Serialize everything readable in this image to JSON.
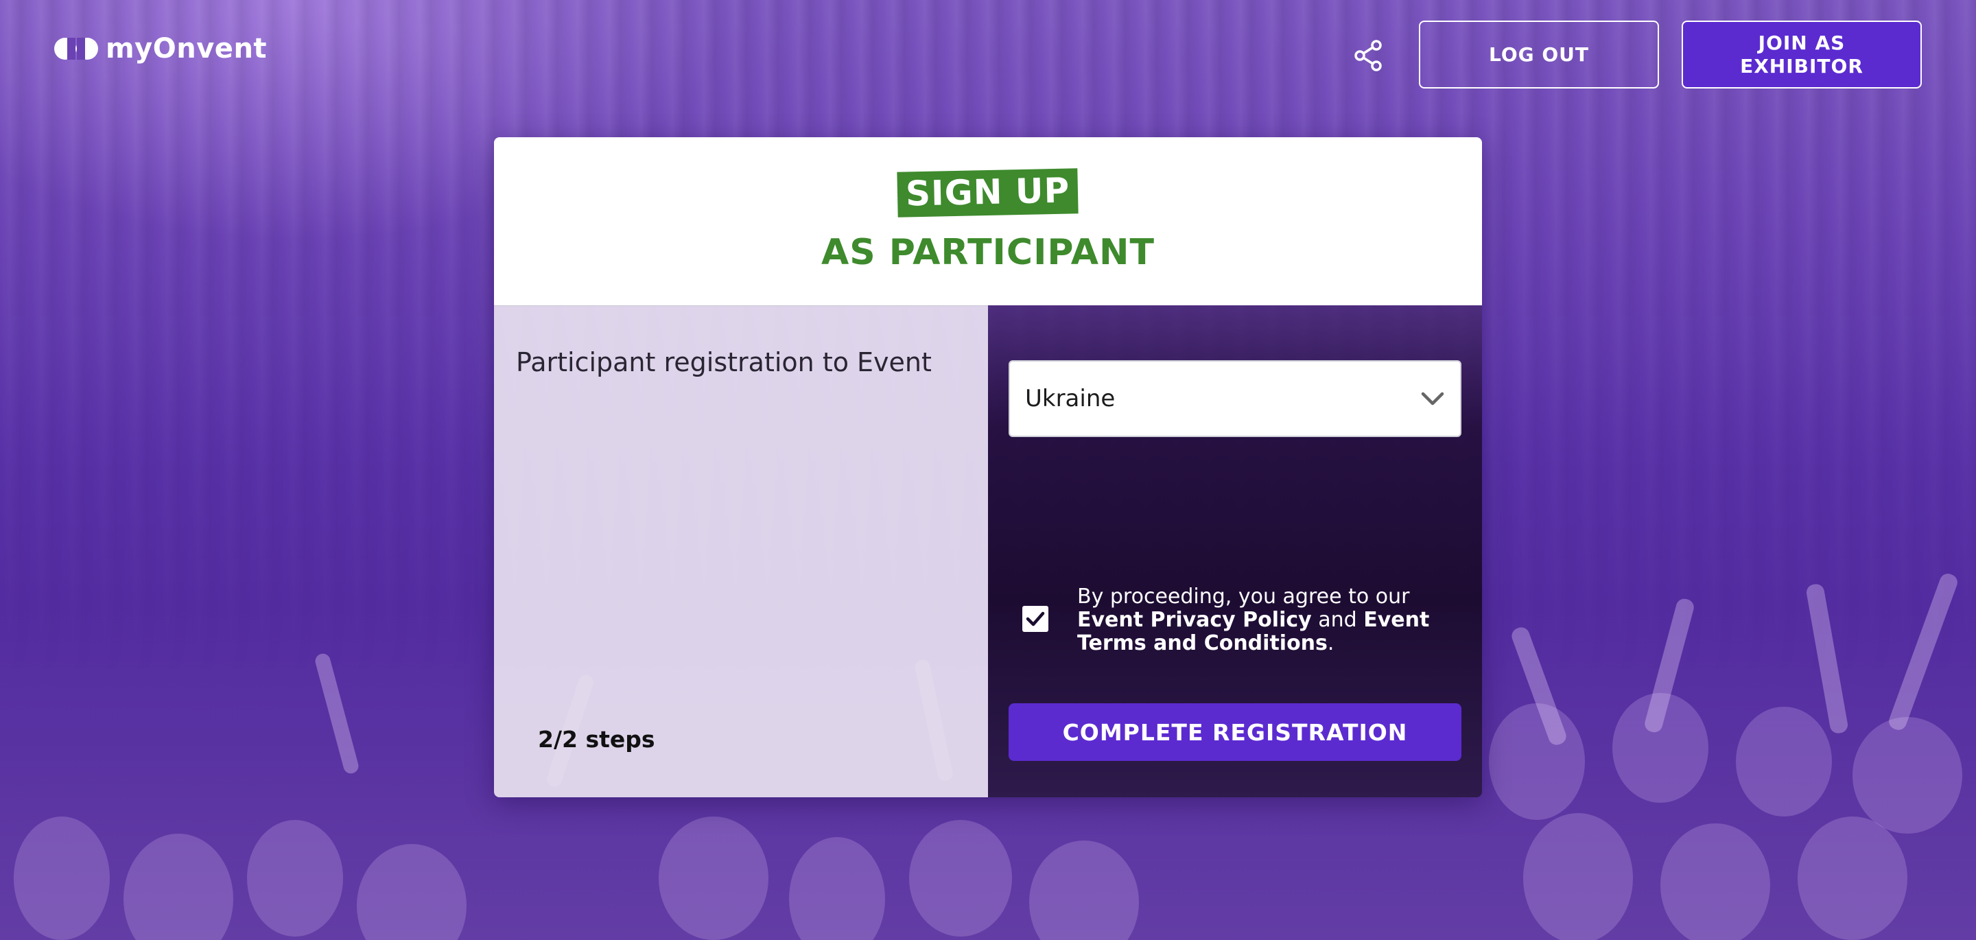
{
  "header": {
    "logo_text": "myOnvent",
    "share_icon": "share-icon",
    "logout_label": "LOG OUT",
    "exhibitor_label": "JOIN AS EXHIBITOR"
  },
  "card": {
    "badge": "SIGN UP",
    "subtitle": "AS PARTICIPANT",
    "left": {
      "title": "Participant registration to Event",
      "steps": "2/2 steps"
    },
    "form": {
      "country_value": "Ukraine",
      "dropdown_icon": "chevron-down-icon",
      "agree_checked": true,
      "agree_prefix": "By proceeding, you agree to our ",
      "privacy_link": "Event Privacy Policy",
      "agree_and": " and ",
      "terms_link": "Event Terms and Conditions",
      "agree_suffix": ".",
      "submit_label": "COMPLETE REGISTRATION"
    }
  },
  "colors": {
    "brand_purple": "#5b2bd0",
    "accent_green": "#3e8a2d",
    "background_purple": "#5a2fa6"
  }
}
